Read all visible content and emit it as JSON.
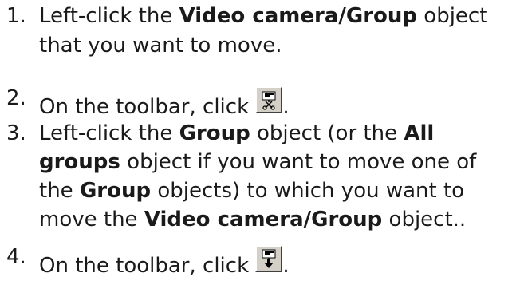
{
  "steps": [
    {
      "number": "1.",
      "lines": [
        [
          "Left-click the ",
          {
            "b": "Video camera/Group"
          },
          " object"
        ],
        [
          "that you want to move."
        ]
      ]
    },
    {
      "number": "2.",
      "text_before_icon": "On the toolbar, click",
      "icon": "cut-camera-icon",
      "text_after_icon": "."
    },
    {
      "number": "3.",
      "lines": [
        [
          "Left-click the ",
          {
            "b": "Group"
          },
          " object (or the ",
          {
            "b": "All"
          }
        ],
        [
          {
            "b": "groups"
          },
          " object if you want to move one of"
        ],
        [
          "the ",
          {
            "b": "Group"
          },
          " objects) to which you want to"
        ],
        [
          "move the ",
          {
            "b": "Video camera/Group"
          },
          " object.."
        ]
      ]
    },
    {
      "number": "4.",
      "text_before_icon": "On the toolbar, click",
      "icon": "paste-camera-icon",
      "text_after_icon": "."
    }
  ]
}
